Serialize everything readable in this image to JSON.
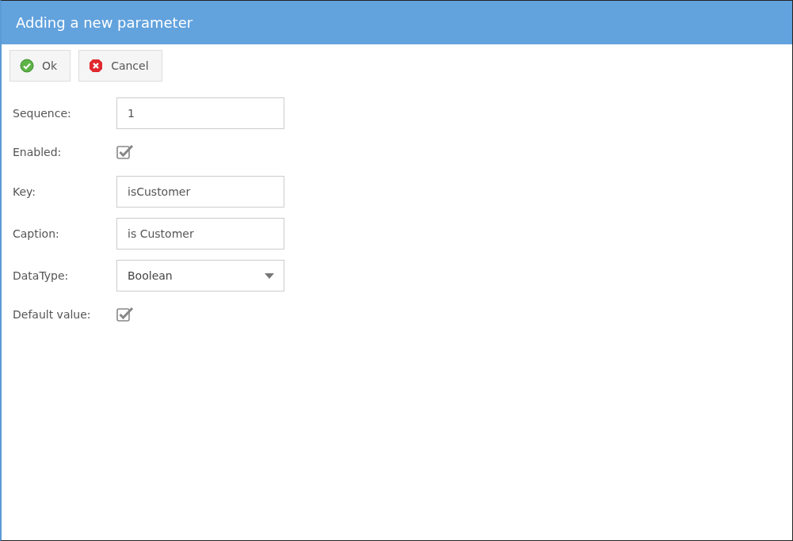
{
  "window": {
    "title": "Adding a new parameter"
  },
  "buttons": [
    {
      "kind": "ok",
      "label": "Ok"
    },
    {
      "kind": "cancel",
      "label": "Cancel"
    }
  ],
  "fields": [
    {
      "kind": "text",
      "label": "Sequence:",
      "value": "1"
    },
    {
      "kind": "checkbox",
      "label": "Enabled:",
      "checked": true
    },
    {
      "kind": "text",
      "label": "Key:",
      "value": "isCustomer"
    },
    {
      "kind": "text",
      "label": "Caption:",
      "value": "is Customer"
    },
    {
      "kind": "select",
      "label": "DataType:",
      "value": "Boolean"
    },
    {
      "kind": "checkbox",
      "label": "Default value:",
      "checked": true
    }
  ]
}
